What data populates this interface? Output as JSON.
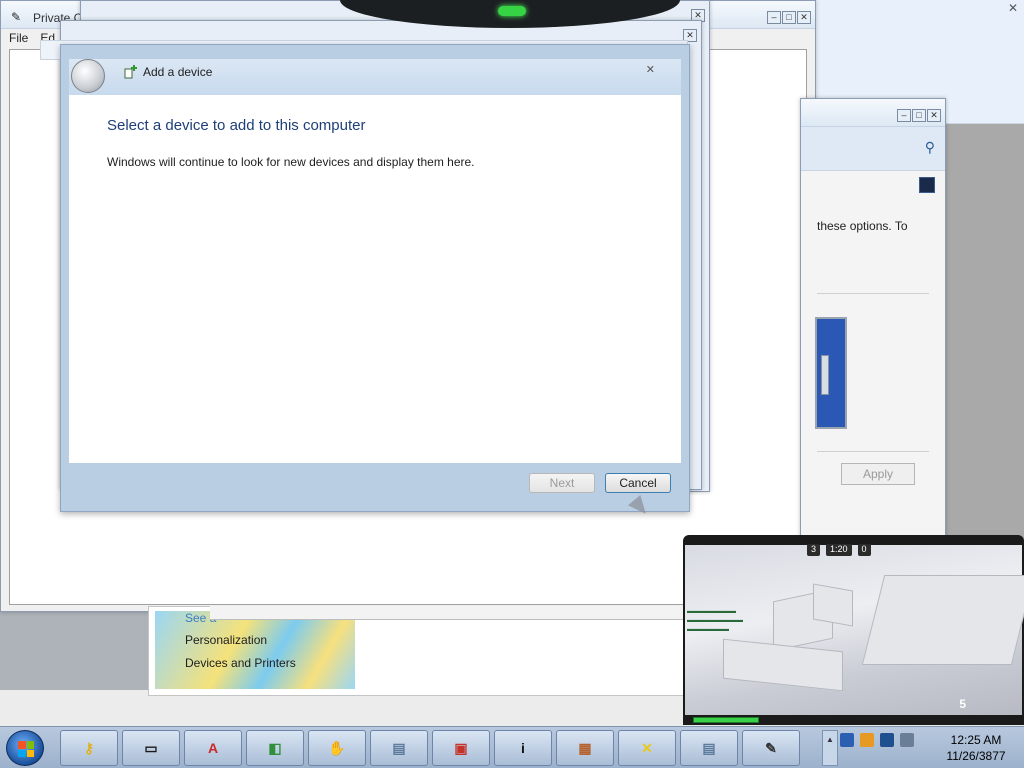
{
  "paint_window": {
    "title": "Private C",
    "menu": [
      "File",
      "Ed"
    ]
  },
  "control_panel": {
    "text_fragment": "these options. To",
    "apply_label": "Apply"
  },
  "personalization_panel": {
    "see_also": "See a",
    "links": [
      "Personalization",
      "Devices and Printers"
    ]
  },
  "wizard": {
    "title": "Add a device",
    "heading": "Select a device to add to this computer",
    "description": "Windows will continue to look for new devices and display them here.",
    "next_label": "Next",
    "cancel_label": "Cancel"
  },
  "game_overlay": {
    "hud": [
      "3",
      "1:20",
      "0"
    ],
    "ammo": "5"
  },
  "taskbar": {
    "items": [
      {
        "icon": "key-icon",
        "color": "#e0b020",
        "glyph": "⚷"
      },
      {
        "icon": "monitor-icon",
        "color": "#1a1a1a",
        "glyph": "▭"
      },
      {
        "icon": "font-icon",
        "color": "#cc2a2a",
        "glyph": "A"
      },
      {
        "icon": "paint-icon",
        "color": "#2f8f3a",
        "glyph": "◧"
      },
      {
        "icon": "hand-icon",
        "color": "#e8c13a",
        "glyph": "✋"
      },
      {
        "icon": "document-icon",
        "color": "#5b7a9c",
        "glyph": "▤"
      },
      {
        "icon": "toolbox-icon",
        "color": "#c4322a",
        "glyph": "▣"
      },
      {
        "icon": "info-icon",
        "color": "#111111",
        "glyph": "i"
      },
      {
        "icon": "bricks-globe-icon",
        "color": "#b5622e",
        "glyph": "▦"
      },
      {
        "icon": "x-app-icon",
        "color": "#e8c81a",
        "glyph": "✕"
      },
      {
        "icon": "document-icon-2",
        "color": "#5b7a9c",
        "glyph": "▤"
      },
      {
        "icon": "pen-icon",
        "color": "#333333",
        "glyph": "✎"
      }
    ],
    "clock_time": "12:25 AM",
    "clock_date": "11/26/3877"
  }
}
